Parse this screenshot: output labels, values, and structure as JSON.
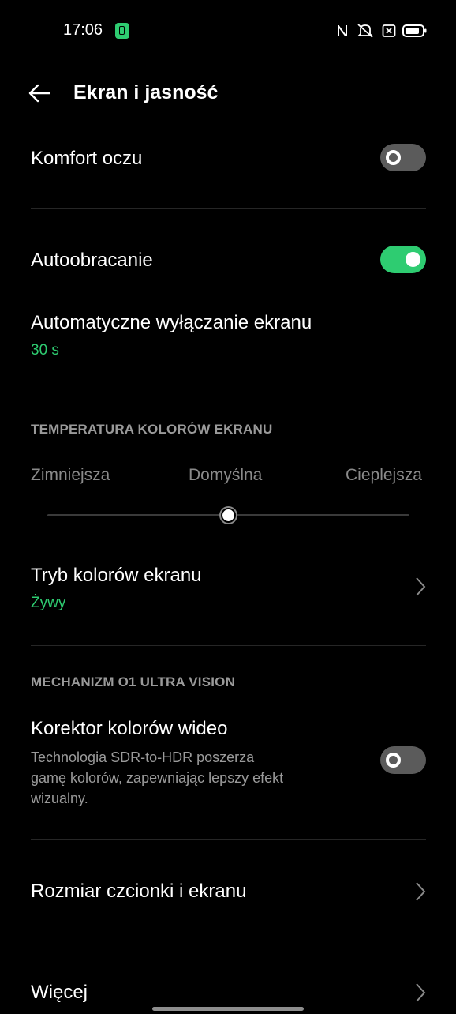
{
  "status_bar": {
    "time": "17:06",
    "icons": [
      "sim-icon",
      "nfc-icon",
      "vibrate-off-icon",
      "no-sim-icon",
      "battery-icon"
    ]
  },
  "header": {
    "title": "Ekran i jasność",
    "back_icon": "back-arrow-icon"
  },
  "eye_comfort": {
    "label": "Komfort oczu",
    "enabled": false
  },
  "auto_rotate": {
    "label": "Autoobracanie",
    "enabled": true
  },
  "screen_timeout": {
    "label": "Automatyczne wyłączanie ekranu",
    "value": "30 s"
  },
  "color_temp": {
    "section_title": "TEMPERATURA KOLORÓW EKRANU",
    "cooler": "Zimniejsza",
    "default": "Domyślna",
    "warmer": "Cieplejsza",
    "level": 0.5
  },
  "color_mode": {
    "label": "Tryb kolorów ekranu",
    "value": "Żywy"
  },
  "ultra_vision": {
    "section_title": "MECHANIZM O1 ULTRA VISION",
    "label": "Korektor kolorów wideo",
    "desc_line1": "Technologia SDR-to-HDR poszerza",
    "desc_line2": "gamę kolorów, zapewniając lepszy efekt",
    "desc_line3": "wizualny.",
    "enabled": false
  },
  "font_size": {
    "label": "Rozmiar czcionki i ekranu"
  },
  "more": {
    "label": "Więcej"
  },
  "colors": {
    "accent": "#2ecc71",
    "background": "#000000",
    "secondary_text": "#9a9a9a"
  }
}
